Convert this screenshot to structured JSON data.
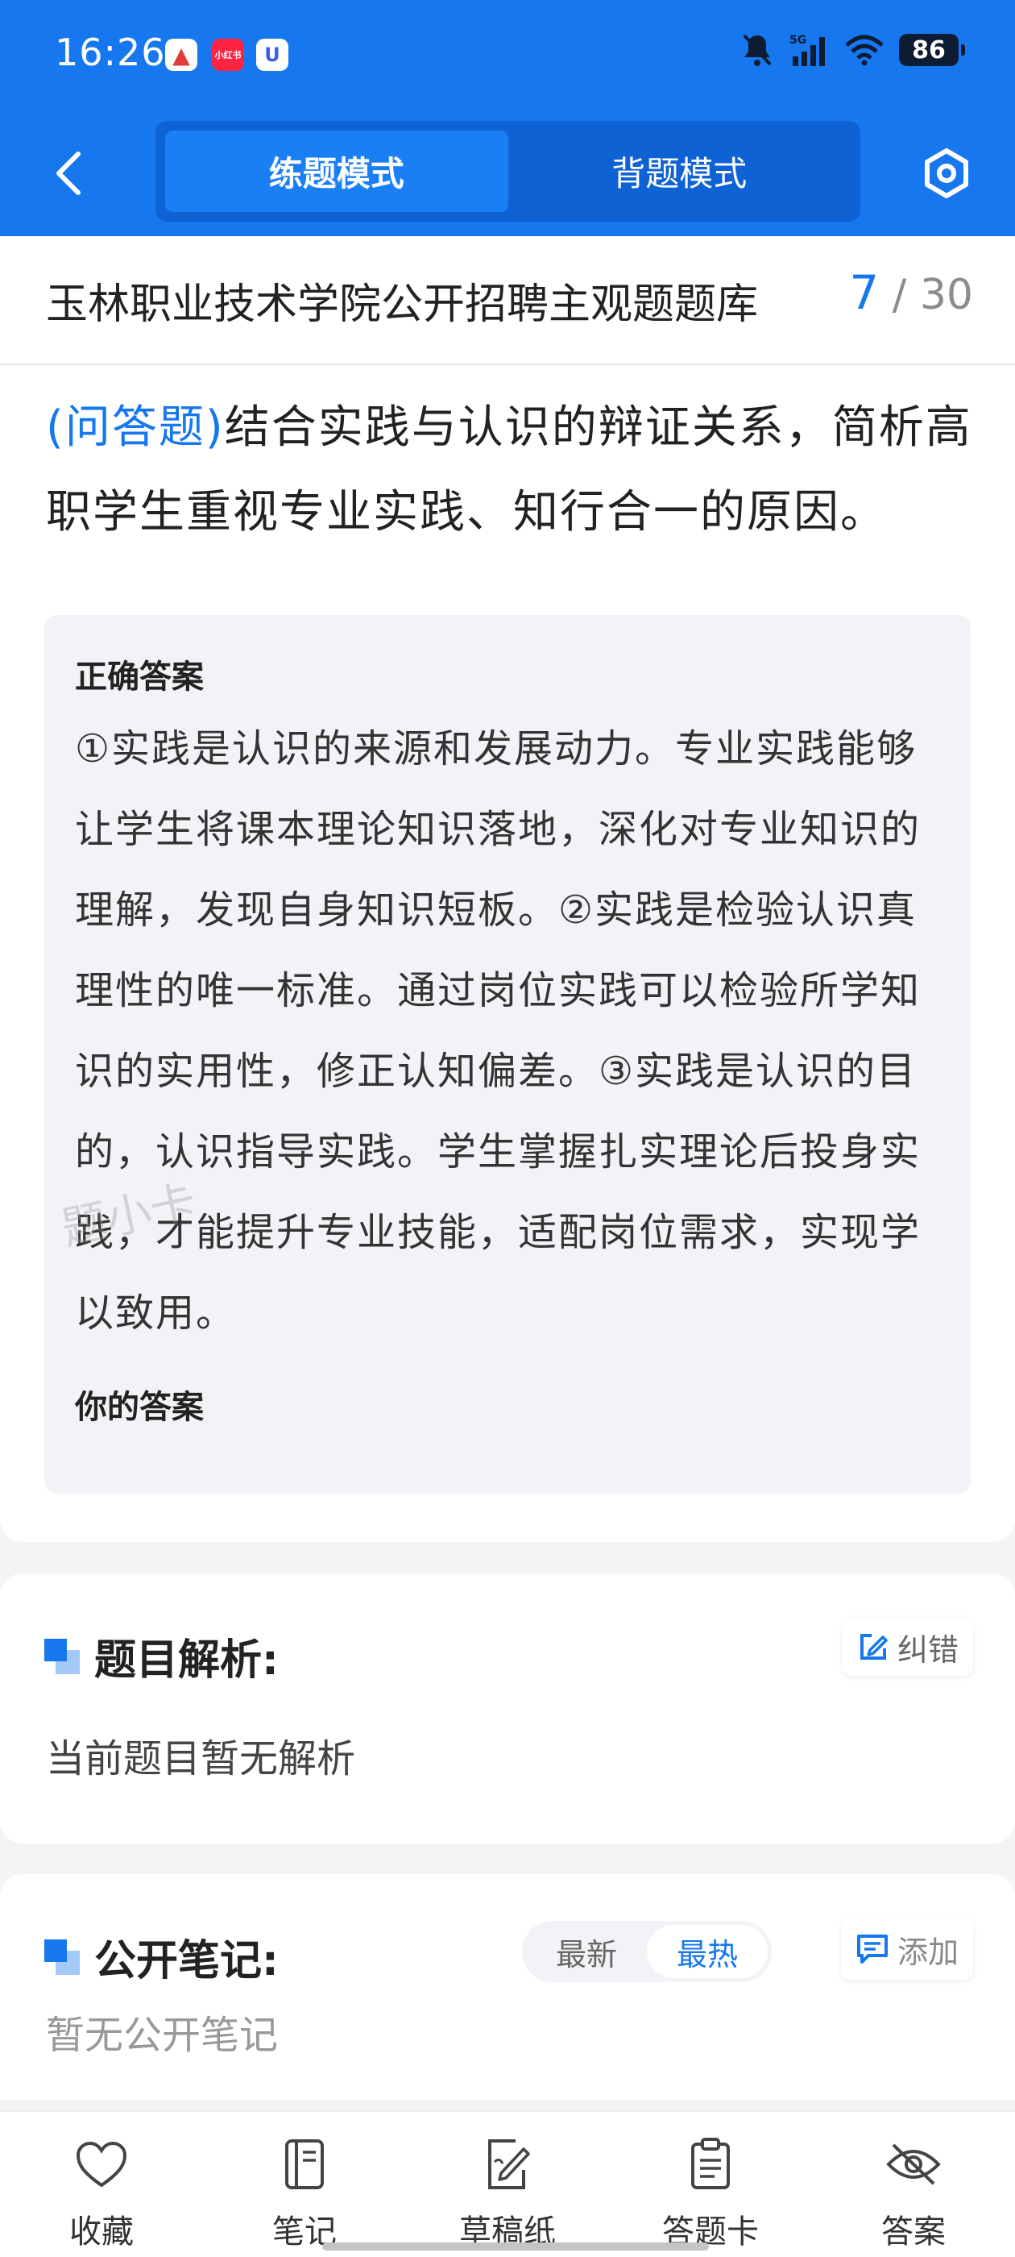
{
  "status_bar": {
    "time": "16:26",
    "network": "5G",
    "battery": "86",
    "app_icons": [
      "app-icon-red",
      "xiaohongshu-icon",
      "shield-app-icon"
    ]
  },
  "nav": {
    "tabs": [
      {
        "label": "练题模式",
        "active": true
      },
      {
        "label": "背题模式",
        "active": false
      }
    ]
  },
  "question_bank": {
    "title": "玉林职业技术学院公开招聘主观题题库",
    "current": "7",
    "total": "30"
  },
  "question": {
    "type": "(问答题)",
    "text": "结合实践与认识的辩证关系，简析高职学生重视专业实践、知行合一的原因。"
  },
  "answer": {
    "correct_label": "正确答案",
    "correct_text": "①实践是认识的来源和发展动力。专业实践能够让学生将课本理论知识落地，深化对专业知识的理解，发现自身知识短板。②实践是检验认识真理性的唯一标准。通过岗位实践可以检验所学知识的实用性，修正认知偏差。③实践是认识的目的，认识指导实践。学生掌握扎实理论后投身实践，才能提升专业技能，适配岗位需求，实现学以致用。",
    "your_label": "你的答案",
    "watermark": "题小卡"
  },
  "analysis": {
    "heading": "题目解析:",
    "fix_label": "纠错",
    "text": "当前题目暂无解析"
  },
  "notes": {
    "heading": "公开笔记:",
    "sort_options": [
      {
        "label": "最新",
        "active": false
      },
      {
        "label": "最热",
        "active": true
      }
    ],
    "add_label": "添加",
    "empty_text": "暂无公开笔记"
  },
  "bottom_bar": {
    "items": [
      {
        "label": "收藏",
        "icon": "heart-icon"
      },
      {
        "label": "笔记",
        "icon": "notebook-icon"
      },
      {
        "label": "草稿纸",
        "icon": "draft-paper-icon"
      },
      {
        "label": "答题卡",
        "icon": "answer-card-icon"
      },
      {
        "label": "答案",
        "icon": "eye-off-icon"
      }
    ]
  },
  "colors": {
    "primary": "#1677ee",
    "primary_dark": "#0f62d4",
    "background": "#f3f4f6"
  }
}
